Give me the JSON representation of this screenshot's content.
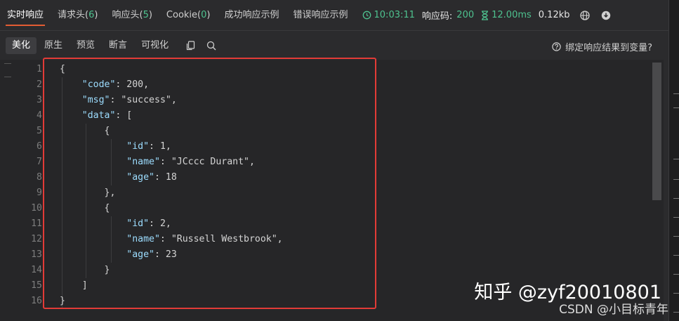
{
  "tabs": [
    {
      "label": "实时响应",
      "count": null
    },
    {
      "label": "请求头",
      "count": "6"
    },
    {
      "label": "响应头",
      "count": "5"
    },
    {
      "label": "Cookie",
      "count": "0"
    },
    {
      "label": "成功响应示例",
      "count": null
    },
    {
      "label": "错误响应示例",
      "count": null
    }
  ],
  "status": {
    "time": "10:03:11",
    "code_label": "响应码:",
    "code_value": "200",
    "duration": "12.00ms",
    "size": "0.12kb"
  },
  "toolbar": {
    "modes": [
      "美化",
      "原生",
      "预览",
      "断言",
      "可视化"
    ],
    "bind_var_label": "绑定响应结果到变量?"
  },
  "code_lines": [
    "{",
    "    \"code\": 200,",
    "    \"msg\": \"success\",",
    "    \"data\": [",
    "        {",
    "            \"id\": 1,",
    "            \"name\": \"JCccc Durant\",",
    "            \"age\": 18",
    "        },",
    "        {",
    "            \"id\": 2,",
    "            \"name\": \"Russell Westbrook\",",
    "            \"age\": 23",
    "        }",
    "    ]",
    "}"
  ],
  "line_numbers": [
    "1",
    "2",
    "3",
    "4",
    "5",
    "6",
    "7",
    "8",
    "9",
    "10",
    "11",
    "12",
    "13",
    "14",
    "15",
    "16"
  ],
  "watermark": {
    "line1": "知乎 @zyf20010801",
    "line2": "CSDN @小目标青年"
  },
  "colors": {
    "accent": "#e25c33",
    "status_green": "#4ec28f",
    "highlight_border": "#e23b37",
    "json_key": "#9cdcfe",
    "json_string": "#ce9178",
    "json_number": "#b5cea8"
  },
  "icons": [
    "clock-icon",
    "hourglass-icon",
    "globe-icon",
    "download-icon",
    "copy-icon",
    "search-icon",
    "help-circle-icon"
  ]
}
